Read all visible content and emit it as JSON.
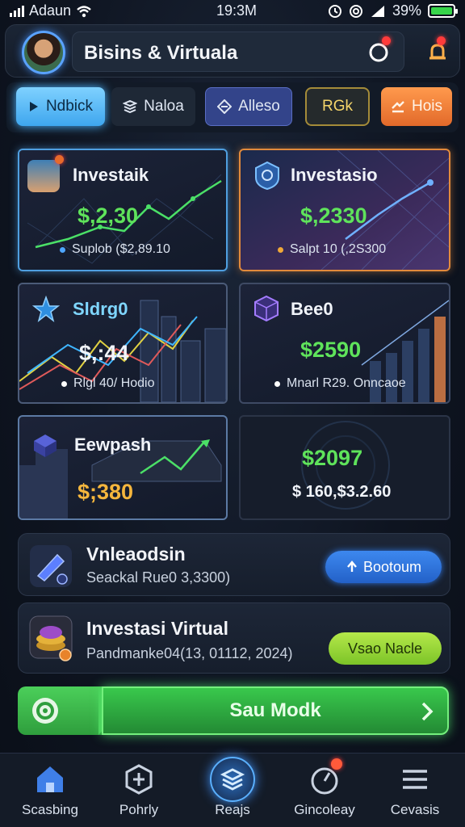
{
  "status_bar": {
    "carrier": "Adaun",
    "time": "19:3M",
    "battery": "39%"
  },
  "header": {
    "title": "Bisins & Virtuala"
  },
  "tabs": [
    {
      "label": "Ndbick",
      "icon": "play-icon"
    },
    {
      "label": "Naloa",
      "icon": "layers-icon"
    },
    {
      "label": "Alleso",
      "icon": "diamond-icon"
    },
    {
      "label": "RGk",
      "icon": ""
    },
    {
      "label": "Hois",
      "icon": "arrows-icon"
    }
  ],
  "cards": [
    {
      "title": "Investaik",
      "amount": "$,2,30",
      "sub": "Suplob ($2,89.10"
    },
    {
      "title": "Investasio",
      "amount": "$,2330",
      "sub": "Salpt 10 (,2S300"
    },
    {
      "title": "Sldrg0",
      "amount": "$,:44",
      "sub": "Rlgl 40/ Hodio"
    },
    {
      "title": "Bee0",
      "amount": "$2590",
      "sub": "Mnarl R29. Onncaoe"
    },
    {
      "title": "Eewpash",
      "amount": "$;380",
      "sub": ""
    },
    {
      "title": "",
      "amount": "$2097",
      "sub": "$ 160,$3.2.60"
    }
  ],
  "rows": [
    {
      "title": "Vnleaodsin",
      "sub": "Seackal Rue0 3,3300)",
      "button": "Bootoum"
    },
    {
      "title": "Investasi Virtual",
      "sub": "Pandmanke04(13, 01112, 2024)",
      "button": "Vsao Nacle"
    }
  ],
  "cta": {
    "label": "Sau Modk"
  },
  "nav": [
    {
      "label": "Scasbing"
    },
    {
      "label": "Pohrly"
    },
    {
      "label": "Reajs"
    },
    {
      "label": "Gincoleay"
    },
    {
      "label": "Cevasis"
    }
  ],
  "colors": {
    "accent_green": "#5fe35b",
    "accent_blue": "#3ea6ee",
    "accent_orange": "#e28a3c",
    "background": "#0e1420"
  }
}
